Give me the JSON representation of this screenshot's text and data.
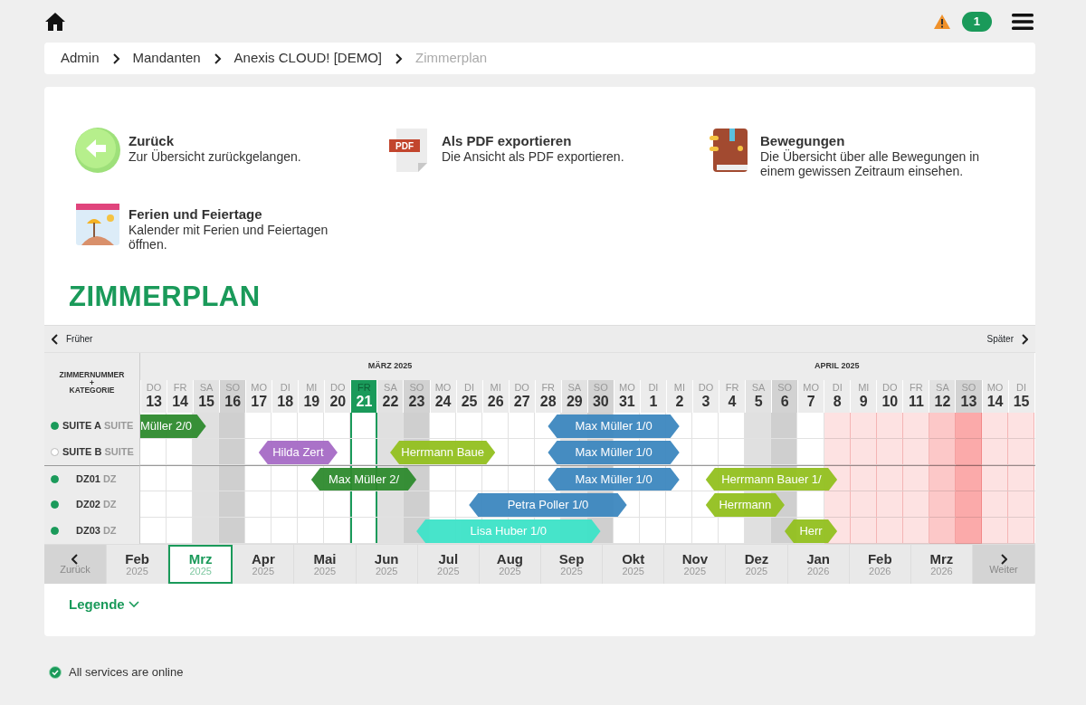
{
  "topbar": {
    "notification_count": "1"
  },
  "breadcrumb": [
    {
      "label": "Admin",
      "current": false
    },
    {
      "label": "Mandanten",
      "current": false
    },
    {
      "label": "Anexis CLOUD! [DEMO]",
      "current": false
    },
    {
      "label": "Zimmerplan",
      "current": true
    }
  ],
  "actions": [
    {
      "kind": "back",
      "title": "Zurück",
      "description": "Zur Übersicht zurückgelangen."
    },
    {
      "kind": "pdf",
      "icon_text": "PDF",
      "title": "Als PDF exportieren",
      "description": "Die Ansicht als PDF exportieren."
    },
    {
      "kind": "book",
      "title": "Bewegungen",
      "description": "Die Übersicht über alle Bewegungen in einem gewissen Zeitraum einsehen."
    },
    {
      "kind": "calendar",
      "title": "Ferien und Feiertage",
      "description": "Kalender mit Ferien und Feiertagen öffnen."
    }
  ],
  "heading": "ZIMMERPLAN",
  "planner": {
    "earlier": "Früher",
    "later": "Später",
    "room_header": [
      "ZIMMERNUMMER",
      "+",
      "KATEGORIE"
    ],
    "months": [
      {
        "label": "MÄRZ 2025",
        "days": [
          {
            "weekday": "DO",
            "day": "13",
            "kind": "wd",
            "selected": false,
            "closed": false
          },
          {
            "weekday": "FR",
            "day": "14",
            "kind": "wd",
            "selected": false,
            "closed": false
          },
          {
            "weekday": "SA",
            "day": "15",
            "kind": "sa",
            "selected": false,
            "closed": false
          },
          {
            "weekday": "SO",
            "day": "16",
            "kind": "so",
            "selected": false,
            "closed": false
          },
          {
            "weekday": "MO",
            "day": "17",
            "kind": "wd",
            "selected": false,
            "closed": false
          },
          {
            "weekday": "DI",
            "day": "18",
            "kind": "wd",
            "selected": false,
            "closed": false
          },
          {
            "weekday": "MI",
            "day": "19",
            "kind": "wd",
            "selected": false,
            "closed": false
          },
          {
            "weekday": "DO",
            "day": "20",
            "kind": "wd",
            "selected": false,
            "closed": false
          },
          {
            "weekday": "FR",
            "day": "21",
            "kind": "wd",
            "selected": true,
            "closed": false
          },
          {
            "weekday": "SA",
            "day": "22",
            "kind": "sa",
            "selected": false,
            "closed": false
          },
          {
            "weekday": "SO",
            "day": "23",
            "kind": "so",
            "selected": false,
            "closed": false
          },
          {
            "weekday": "MO",
            "day": "24",
            "kind": "wd",
            "selected": false,
            "closed": false
          },
          {
            "weekday": "DI",
            "day": "25",
            "kind": "wd",
            "selected": false,
            "closed": false
          },
          {
            "weekday": "MI",
            "day": "26",
            "kind": "wd",
            "selected": false,
            "closed": false
          },
          {
            "weekday": "DO",
            "day": "27",
            "kind": "wd",
            "selected": false,
            "closed": false
          },
          {
            "weekday": "FR",
            "day": "28",
            "kind": "wd",
            "selected": false,
            "closed": false
          },
          {
            "weekday": "SA",
            "day": "29",
            "kind": "sa",
            "selected": false,
            "closed": false
          },
          {
            "weekday": "SO",
            "day": "30",
            "kind": "so",
            "selected": false,
            "closed": false
          },
          {
            "weekday": "MO",
            "day": "31",
            "kind": "wd",
            "selected": false,
            "closed": false
          }
        ]
      },
      {
        "label": "APRIL 2025",
        "days": [
          {
            "weekday": "DI",
            "day": "1",
            "kind": "wd",
            "selected": false,
            "closed": false
          },
          {
            "weekday": "MI",
            "day": "2",
            "kind": "wd",
            "selected": false,
            "closed": false
          },
          {
            "weekday": "DO",
            "day": "3",
            "kind": "wd",
            "selected": false,
            "closed": false
          },
          {
            "weekday": "FR",
            "day": "4",
            "kind": "wd",
            "selected": false,
            "closed": false
          },
          {
            "weekday": "SA",
            "day": "5",
            "kind": "sa",
            "selected": false,
            "closed": false
          },
          {
            "weekday": "SO",
            "day": "6",
            "kind": "so",
            "selected": false,
            "closed": false
          },
          {
            "weekday": "MO",
            "day": "7",
            "kind": "wd",
            "selected": false,
            "closed": false
          },
          {
            "weekday": "DI",
            "day": "8",
            "kind": "wd",
            "selected": false,
            "closed": true
          },
          {
            "weekday": "MI",
            "day": "9",
            "kind": "wd",
            "selected": false,
            "closed": true
          },
          {
            "weekday": "DO",
            "day": "10",
            "kind": "wd",
            "selected": false,
            "closed": true
          },
          {
            "weekday": "FR",
            "day": "11",
            "kind": "wd",
            "selected": false,
            "closed": true
          },
          {
            "weekday": "SA",
            "day": "12",
            "kind": "sa",
            "selected": false,
            "closed": true
          },
          {
            "weekday": "SO",
            "day": "13",
            "kind": "so",
            "selected": false,
            "closed": true
          },
          {
            "weekday": "MO",
            "day": "14",
            "kind": "wd",
            "selected": false,
            "closed": true
          },
          {
            "weekday": "DI",
            "day": "15",
            "kind": "wd",
            "selected": false,
            "closed": true
          }
        ]
      }
    ],
    "rooms": [
      {
        "number": "SUITE A",
        "category": "SUITE",
        "active": true,
        "timeline": [
          {
            "kind": "continued",
            "guest": "Müller 2/0",
            "color": "#2e8b2e"
          },
          {
            "kind": "night"
          },
          {
            "kind": "free"
          },
          {
            "kind": "free"
          },
          {
            "kind": "free"
          },
          {
            "kind": "free"
          },
          {
            "kind": "free"
          },
          {
            "kind": "free"
          },
          {
            "kind": "free"
          },
          {
            "kind": "free"
          },
          {
            "kind": "free"
          },
          {
            "kind": "free"
          },
          {
            "kind": "free"
          },
          {
            "kind": "free"
          },
          {
            "kind": "free"
          },
          {
            "kind": "arrive",
            "guest": "Max Müller 1/0",
            "color": "#3d87bf"
          },
          {
            "kind": "night"
          },
          {
            "kind": "night"
          },
          {
            "kind": "night"
          },
          {
            "kind": "night"
          },
          {
            "kind": "free"
          },
          {
            "kind": "free"
          },
          {
            "kind": "free"
          },
          {
            "kind": "free"
          },
          {
            "kind": "free"
          },
          {
            "kind": "free"
          },
          {
            "kind": "free"
          },
          {
            "kind": "free"
          },
          {
            "kind": "free"
          },
          {
            "kind": "free"
          },
          {
            "kind": "free"
          },
          {
            "kind": "free"
          },
          {
            "kind": "free"
          },
          {
            "kind": "free"
          }
        ]
      },
      {
        "number": "SUITE B",
        "category": "SUITE",
        "active": false,
        "timeline": [
          {
            "kind": "free"
          },
          {
            "kind": "free"
          },
          {
            "kind": "free"
          },
          {
            "kind": "free"
          },
          {
            "kind": "arrive",
            "guest": "Hilda Zert",
            "color": "#a66bc6"
          },
          {
            "kind": "night"
          },
          {
            "kind": "night"
          },
          {
            "kind": "free"
          },
          {
            "kind": "free"
          },
          {
            "kind": "arrive",
            "guest": "Herrmann Baue",
            "color": "#93c01f"
          },
          {
            "kind": "night"
          },
          {
            "kind": "night"
          },
          {
            "kind": "night"
          },
          {
            "kind": "free"
          },
          {
            "kind": "free"
          },
          {
            "kind": "arrive",
            "guest": "Max Müller 1/0",
            "color": "#3d87bf"
          },
          {
            "kind": "night"
          },
          {
            "kind": "night"
          },
          {
            "kind": "night"
          },
          {
            "kind": "night"
          },
          {
            "kind": "free"
          },
          {
            "kind": "free"
          },
          {
            "kind": "free"
          },
          {
            "kind": "free"
          },
          {
            "kind": "free"
          },
          {
            "kind": "free"
          },
          {
            "kind": "free"
          },
          {
            "kind": "free"
          },
          {
            "kind": "free"
          },
          {
            "kind": "free"
          },
          {
            "kind": "free"
          },
          {
            "kind": "free"
          },
          {
            "kind": "free"
          },
          {
            "kind": "free"
          }
        ]
      },
      {
        "number": "DZ01",
        "category": "DZ",
        "active": true,
        "timeline": [
          {
            "kind": "free"
          },
          {
            "kind": "free"
          },
          {
            "kind": "free"
          },
          {
            "kind": "free"
          },
          {
            "kind": "free"
          },
          {
            "kind": "free"
          },
          {
            "kind": "arrive",
            "guest": "Max Müller 2/",
            "color": "#2e8b2e"
          },
          {
            "kind": "night"
          },
          {
            "kind": "night"
          },
          {
            "kind": "night"
          },
          {
            "kind": "free"
          },
          {
            "kind": "free"
          },
          {
            "kind": "free"
          },
          {
            "kind": "free"
          },
          {
            "kind": "free"
          },
          {
            "kind": "arrive",
            "guest": "Max Müller 1/0",
            "color": "#3d87bf"
          },
          {
            "kind": "night"
          },
          {
            "kind": "night"
          },
          {
            "kind": "night"
          },
          {
            "kind": "night"
          },
          {
            "kind": "free"
          },
          {
            "kind": "arrive",
            "guest": "Herrmann Bauer 1/",
            "color": "#93c01f"
          },
          {
            "kind": "night"
          },
          {
            "kind": "night"
          },
          {
            "kind": "night"
          },
          {
            "kind": "night"
          },
          {
            "kind": "free"
          },
          {
            "kind": "free"
          },
          {
            "kind": "free"
          },
          {
            "kind": "free"
          },
          {
            "kind": "free"
          },
          {
            "kind": "free"
          },
          {
            "kind": "free"
          },
          {
            "kind": "free"
          }
        ]
      },
      {
        "number": "DZ02",
        "category": "DZ",
        "active": true,
        "timeline": [
          {
            "kind": "free"
          },
          {
            "kind": "free"
          },
          {
            "kind": "free"
          },
          {
            "kind": "free"
          },
          {
            "kind": "free"
          },
          {
            "kind": "free"
          },
          {
            "kind": "free"
          },
          {
            "kind": "free"
          },
          {
            "kind": "free"
          },
          {
            "kind": "free"
          },
          {
            "kind": "free"
          },
          {
            "kind": "free"
          },
          {
            "kind": "arrive",
            "guest": "Petra Poller 1/0",
            "color": "#3d87bf"
          },
          {
            "kind": "night"
          },
          {
            "kind": "night"
          },
          {
            "kind": "night"
          },
          {
            "kind": "night"
          },
          {
            "kind": "night"
          },
          {
            "kind": "free"
          },
          {
            "kind": "free"
          },
          {
            "kind": "free"
          },
          {
            "kind": "arrive",
            "guest": "Herrmann",
            "color": "#93c01f"
          },
          {
            "kind": "night"
          },
          {
            "kind": "night"
          },
          {
            "kind": "free"
          },
          {
            "kind": "free"
          },
          {
            "kind": "free"
          },
          {
            "kind": "free"
          },
          {
            "kind": "free"
          },
          {
            "kind": "free"
          },
          {
            "kind": "free"
          },
          {
            "kind": "free"
          },
          {
            "kind": "free"
          },
          {
            "kind": "free"
          }
        ]
      },
      {
        "number": "DZ03",
        "category": "DZ",
        "active": true,
        "timeline": [
          {
            "kind": "free"
          },
          {
            "kind": "free"
          },
          {
            "kind": "free"
          },
          {
            "kind": "free"
          },
          {
            "kind": "free"
          },
          {
            "kind": "free"
          },
          {
            "kind": "free"
          },
          {
            "kind": "free"
          },
          {
            "kind": "free"
          },
          {
            "kind": "free"
          },
          {
            "kind": "arrive",
            "guest": "Lisa Huber 1/0",
            "color": "#3de3c8"
          },
          {
            "kind": "night"
          },
          {
            "kind": "night"
          },
          {
            "kind": "night"
          },
          {
            "kind": "night"
          },
          {
            "kind": "night"
          },
          {
            "kind": "night"
          },
          {
            "kind": "free"
          },
          {
            "kind": "free"
          },
          {
            "kind": "free"
          },
          {
            "kind": "free"
          },
          {
            "kind": "free"
          },
          {
            "kind": "free"
          },
          {
            "kind": "free"
          },
          {
            "kind": "arrive",
            "guest": "Herr",
            "color": "#93c01f"
          },
          {
            "kind": "night"
          },
          {
            "kind": "free"
          },
          {
            "kind": "free"
          },
          {
            "kind": "free"
          },
          {
            "kind": "free"
          },
          {
            "kind": "free"
          },
          {
            "kind": "free"
          },
          {
            "kind": "free"
          },
          {
            "kind": "free"
          }
        ]
      }
    ],
    "pager": {
      "back": "Zurück",
      "next": "Weiter",
      "months": [
        {
          "month": "Feb",
          "year": "2025",
          "selected": false
        },
        {
          "month": "Mrz",
          "year": "2025",
          "selected": true
        },
        {
          "month": "Apr",
          "year": "2025",
          "selected": false
        },
        {
          "month": "Mai",
          "year": "2025",
          "selected": false
        },
        {
          "month": "Jun",
          "year": "2025",
          "selected": false
        },
        {
          "month": "Jul",
          "year": "2025",
          "selected": false
        },
        {
          "month": "Aug",
          "year": "2025",
          "selected": false
        },
        {
          "month": "Sep",
          "year": "2025",
          "selected": false
        },
        {
          "month": "Okt",
          "year": "2025",
          "selected": false
        },
        {
          "month": "Nov",
          "year": "2025",
          "selected": false
        },
        {
          "month": "Dez",
          "year": "2025",
          "selected": false
        },
        {
          "month": "Jan",
          "year": "2026",
          "selected": false
        },
        {
          "month": "Feb",
          "year": "2026",
          "selected": false
        },
        {
          "month": "Mrz",
          "year": "2026",
          "selected": false
        }
      ]
    }
  },
  "legend": {
    "label": "Legende",
    "expanded": false
  },
  "status": "All services are online"
}
